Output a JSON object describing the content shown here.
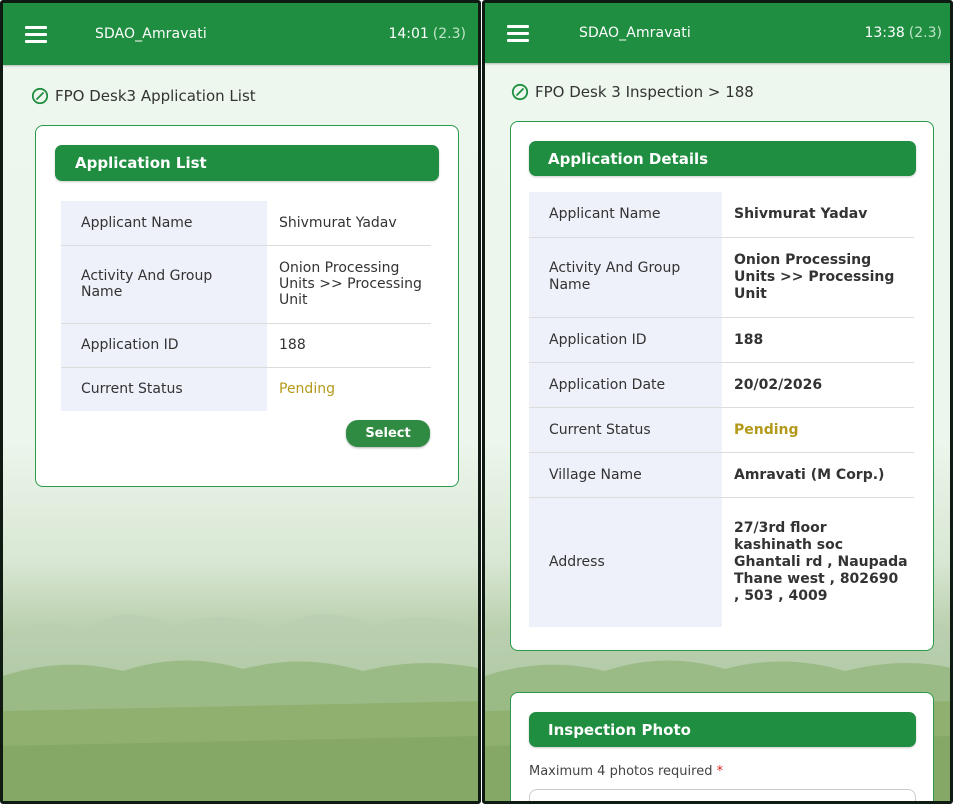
{
  "left": {
    "appbar": {
      "user": "SDAO_Amravati",
      "time": "14:01",
      "version": "(2.3)"
    },
    "page_title": "FPO Desk3 Application List",
    "card_title": "Application List",
    "rows": [
      {
        "label": "Applicant Name",
        "value": "Shivmurat Yadav"
      },
      {
        "label": "Activity And Group Name",
        "value": "Onion Processing Units >> Processing Unit"
      },
      {
        "label": "Application ID",
        "value": "188"
      },
      {
        "label": "Current Status",
        "value": "Pending"
      }
    ],
    "select_label": "Select"
  },
  "right": {
    "appbar": {
      "user": "SDAO_Amravati",
      "time": "13:38",
      "version": "(2.3)"
    },
    "page_title": "FPO Desk 3 Inspection > 188",
    "card_title": "Application Details",
    "rows": [
      {
        "label": "Applicant Name",
        "value": "Shivmurat Yadav"
      },
      {
        "label": "Activity And Group Name",
        "value": "Onion Processing Units >> Processing Unit"
      },
      {
        "label": "Application ID",
        "value": "188"
      },
      {
        "label": "Application Date",
        "value": "20/02/2026"
      },
      {
        "label": "Current Status",
        "value": "Pending"
      },
      {
        "label": "Village Name",
        "value": "Amravati (M Corp.)"
      },
      {
        "label": "Address",
        "value": "27/3rd floor kashinath soc Ghantali rd , Naupada Thane west , 802690 , 503 , 4009"
      }
    ],
    "photo_card_title": "Inspection Photo",
    "photo_hint": "Maximum 4 photos required",
    "photo_required_mark": "*"
  },
  "colors": {
    "primary": "#1f8e40",
    "pending": "#b49a1a",
    "label_bg": "#eef1fa"
  }
}
